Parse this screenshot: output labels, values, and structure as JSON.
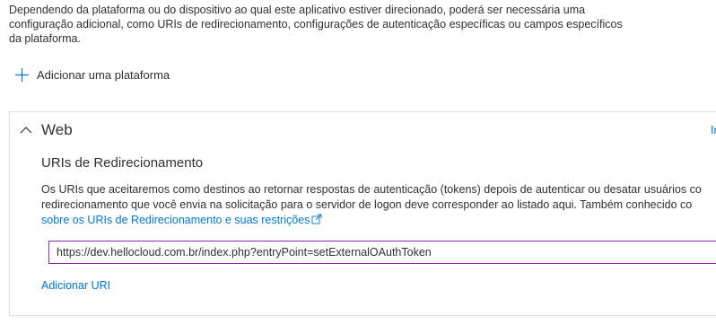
{
  "intro": {
    "line1": "Dependendo da plataforma ou do dispositivo ao qual este aplicativo estiver direcionado, poderá ser necessária uma",
    "line2": "configuração adicional, como URIs de redirecionamento, configurações de autenticação específicas ou campos específicos",
    "line3": "da plataforma."
  },
  "add_platform": {
    "icon": "plus-icon",
    "label": "Adicionar uma plataforma"
  },
  "web_card": {
    "title": "Web",
    "collapse_icon": "chevron-up-icon",
    "right_link_text": "Ir",
    "redirect_section": {
      "title": "URIs de Redirecionamento",
      "desc_line1": "Os URIs que aceitaremos como destinos ao retornar respostas de autenticação (tokens) depois de autenticar ou desatar usuários co",
      "desc_line2": "redirecionamento que você envia na solicitação para o servidor de logon deve corresponder ao listado aqui. Também conhecido co",
      "desc_link": "sobre os URIs de Redirecionamento e suas restrições",
      "external_icon": "external-link-icon",
      "uri_value": "https://dev.hellocloud.com.br/index.php?entryPoint=setExternalOAuthToken",
      "add_uri_label": "Adicionar URI"
    }
  },
  "colors": {
    "link": "#0078d4",
    "input_focus_border": "#8a2da5",
    "text": "#323130",
    "card_border": "#e1dfdd"
  }
}
